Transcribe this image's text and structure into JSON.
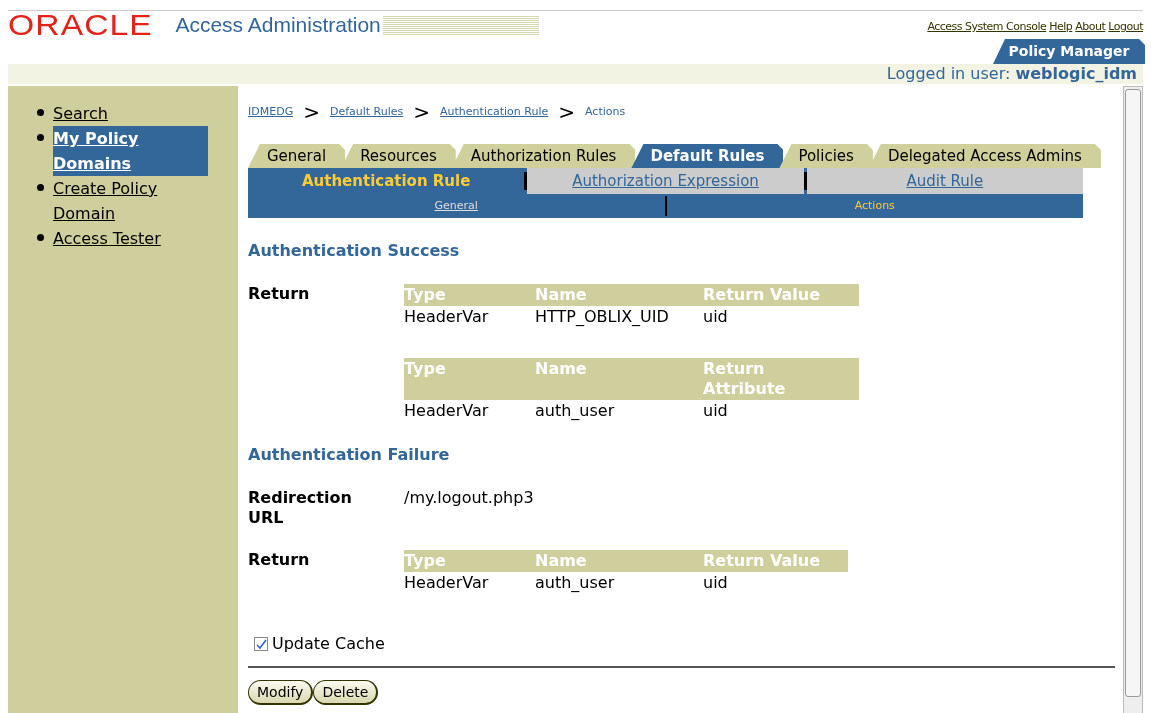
{
  "header": {
    "logo": "ORACLE",
    "title": "Access Administration",
    "links": [
      "Access System Console",
      "Help",
      "About",
      "Logout"
    ],
    "app_tabs": [
      {
        "label": "Policy Manager",
        "selected": true
      }
    ],
    "logged_in": "Logged in user: **weblogic_idm**"
  },
  "sidebar": {
    "items": [
      {
        "label": "Search",
        "selected": false
      },
      {
        "label": "My Policy Domains",
        "selected": true
      },
      {
        "label": "Create Policy Domain",
        "selected": false
      },
      {
        "label": "Access Tester",
        "selected": false
      }
    ]
  },
  "breadcrumb": [
    {
      "label": "IDMEDG",
      "kind": "link"
    },
    {
      "label": ">",
      "kind": "separator"
    },
    {
      "label": "Default Rules",
      "kind": "link"
    },
    {
      "label": ">",
      "kind": "separator"
    },
    {
      "label": "Authentication Rule",
      "kind": "link"
    },
    {
      "label": ">",
      "kind": "separator"
    },
    {
      "label": "Actions",
      "kind": "current"
    }
  ],
  "tabs": [
    {
      "label": "General",
      "selected": false
    },
    {
      "label": "Resources",
      "selected": false
    },
    {
      "label": "Authorization Rules",
      "selected": false
    },
    {
      "label": "Default Rules",
      "selected": true
    },
    {
      "label": "Policies",
      "selected": false
    },
    {
      "label": "Delegated Access Admins",
      "selected": false
    }
  ],
  "subtabs": [
    {
      "label": "Authentication Rule",
      "selected": true
    },
    {
      "label": "Authorization Expression",
      "selected": false
    },
    {
      "label": "Audit Rule",
      "selected": false
    }
  ],
  "subsubtabs": [
    {
      "label": "General",
      "selected": false
    },
    {
      "label": "Actions",
      "selected": true
    }
  ],
  "sections": [
    {
      "heading": "Authentication Success",
      "rows": [
        {
          "label": "Return",
          "kind": "tables",
          "tables": [
            {
              "columns": [
                "Type",
                "Name",
                "Return Value"
              ],
              "rows": [
                [
                  "HeaderVar",
                  "HTTP_OBLIX_UID",
                  "uid"
                ]
              ]
            },
            {
              "columns": [
                "Type",
                "Name",
                "Return Attribute"
              ],
              "rows": [
                [
                  "HeaderVar",
                  "auth_user",
                  "uid"
                ]
              ]
            }
          ]
        }
      ]
    },
    {
      "heading": "Authentication Failure",
      "rows": [
        {
          "label": "Redirection URL",
          "kind": "text",
          "value": "/my.logout.php3"
        },
        {
          "label": "Return",
          "kind": "tables",
          "tables": [
            {
              "columns": [
                "Type",
                "Name",
                "Return Value"
              ],
              "rows": [
                [
                  "HeaderVar",
                  "auth_user",
                  "uid"
                ]
              ]
            }
          ]
        }
      ]
    }
  ],
  "update_cache": {
    "label": "Update Cache",
    "checked": true
  },
  "buttons": [
    "Modify",
    "Delete"
  ]
}
